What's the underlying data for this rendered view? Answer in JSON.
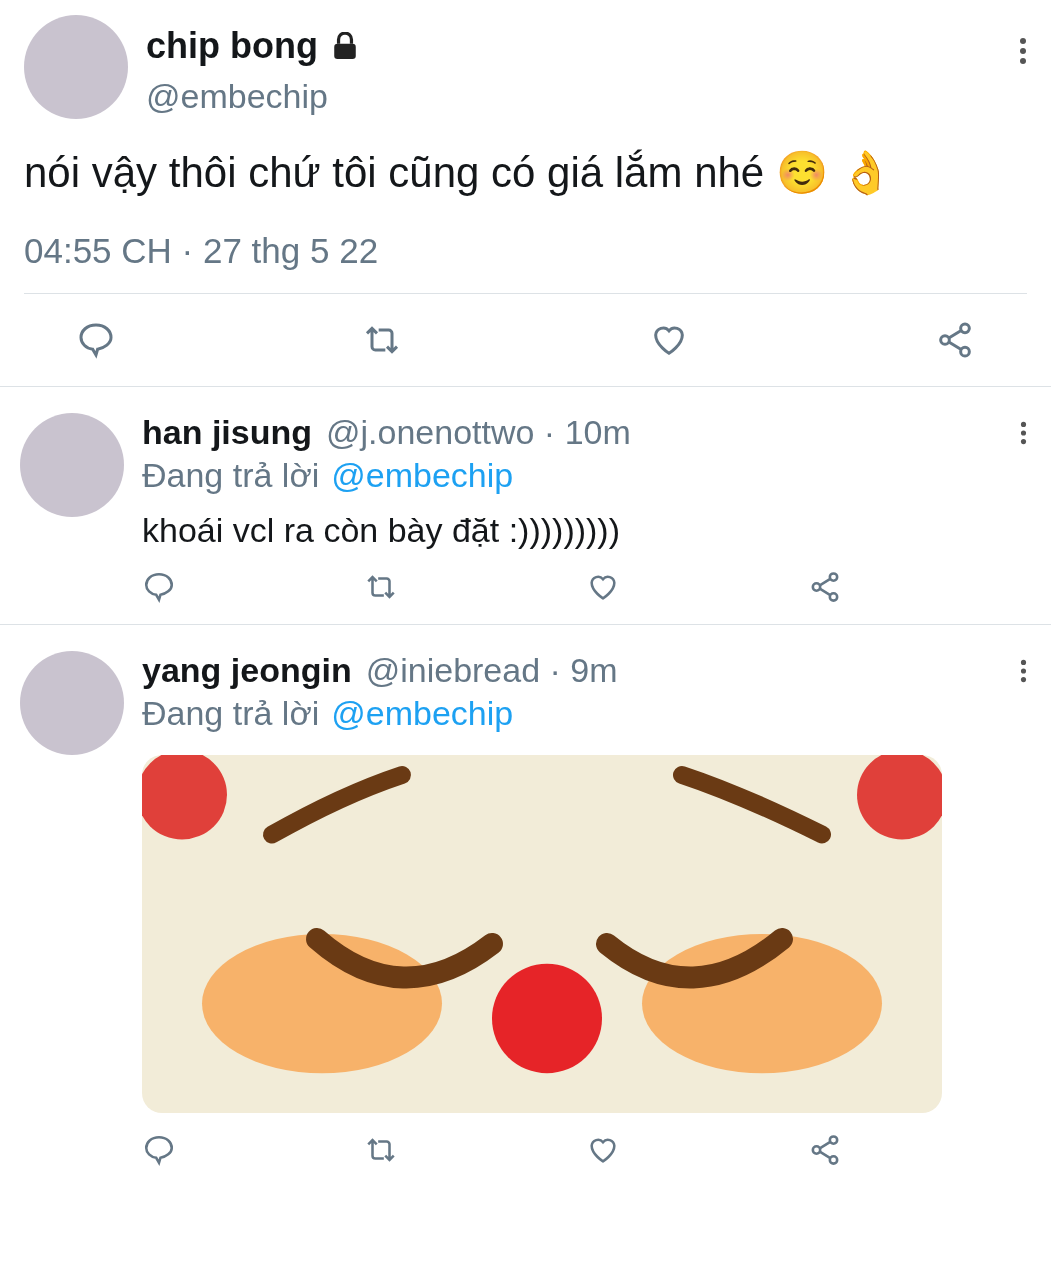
{
  "main_tweet": {
    "author": {
      "name": "chip bong",
      "handle": "@embechip",
      "protected": true
    },
    "text": "nói vậy thôi chứ tôi cũng có giá lắm nhé ☺️ 👌",
    "timestamp": "04:55 CH · 27 thg 5 22"
  },
  "replies": [
    {
      "kind": "text",
      "name": "han jisung",
      "meta": "@j.onenottwo · 10m",
      "replying_label": "Đang trả lời",
      "replying_to": "@embechip",
      "text": "khoái vcl ra còn bày đặt :)))))))))"
    },
    {
      "kind": "image",
      "name": "yang jeongin",
      "meta": "@iniebread · 9m",
      "replying_label": "Đang trả lời",
      "replying_to": "@embechip"
    }
  ]
}
